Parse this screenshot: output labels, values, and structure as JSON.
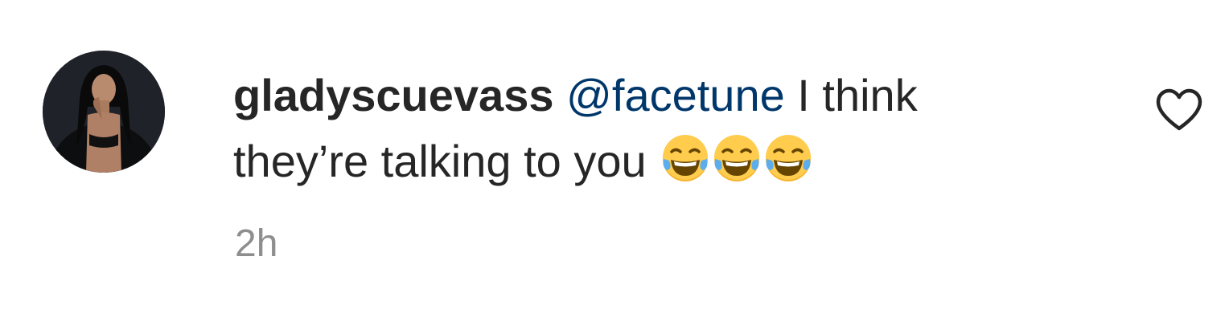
{
  "comment": {
    "username": "gladyscuevass",
    "mention": "@facetune",
    "text_line1": " I think",
    "text_line2": "they’re talking to you ",
    "emojis": [
      "face-with-tears-of-joy-icon",
      "face-with-tears-of-joy-icon",
      "face-with-tears-of-joy-icon"
    ],
    "timestamp": "2h"
  },
  "icons": {
    "like": "heart-outline-icon"
  },
  "colors": {
    "text": "#262626",
    "mention": "#00376b",
    "secondary": "#8e8e8e"
  }
}
